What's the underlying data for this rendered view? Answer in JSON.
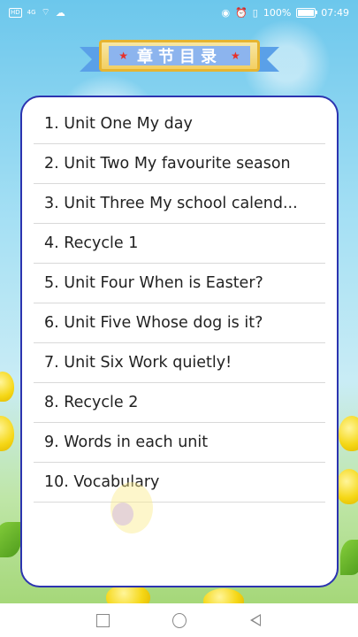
{
  "status_bar": {
    "hd_badge": "HD",
    "signal_label": "4G",
    "battery_percent": "100%",
    "time": "07:49"
  },
  "header": {
    "title": "章节目录"
  },
  "chapters": [
    {
      "label": "1. Unit One My day"
    },
    {
      "label": "2. Unit Two My favourite season"
    },
    {
      "label": "3. Unit Three My school calend..."
    },
    {
      "label": "4. Recycle 1"
    },
    {
      "label": "5. Unit Four When is Easter?"
    },
    {
      "label": "6. Unit Five Whose dog is it?"
    },
    {
      "label": "7. Unit Six Work quietly!"
    },
    {
      "label": "8. Recycle 2"
    },
    {
      "label": "9. Words in each unit"
    },
    {
      "label": "10. Vocabulary"
    }
  ],
  "nav_bar": {
    "recent_icon": "square-icon",
    "home_icon": "circle-icon",
    "back_icon": "triangle-back-icon"
  },
  "colors": {
    "card_border": "#2c34b0",
    "banner_fill": "#8cb4ee",
    "banner_frame": "#f3cf62",
    "star": "#e8302a"
  }
}
